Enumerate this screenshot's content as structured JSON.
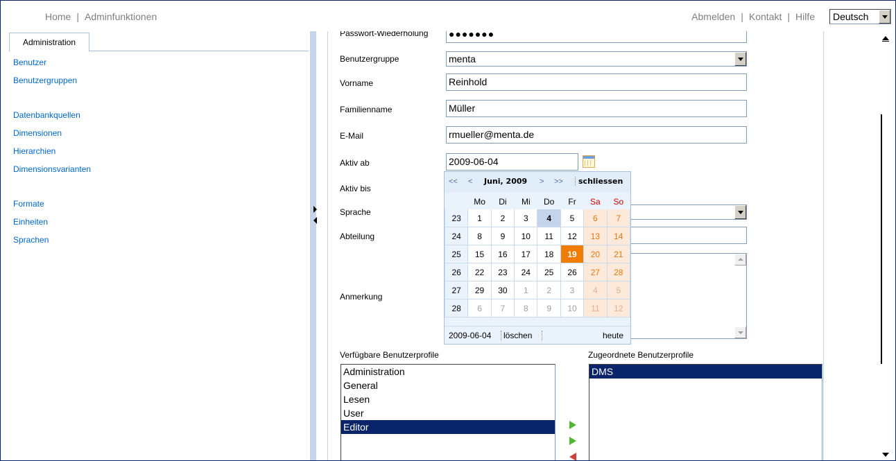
{
  "top_nav": {
    "left": [
      "Home",
      "Adminfunktionen"
    ],
    "right": [
      "Abmelden",
      "Kontakt",
      "Hilfe"
    ],
    "language_selected": "Deutsch"
  },
  "sidebar": {
    "tab": "Administration",
    "groups": [
      [
        "Benutzer",
        "Benutzergruppen"
      ],
      [
        "Datenbankquellen",
        "Dimensionen",
        "Hierarchien",
        "Dimensionsvarianten"
      ],
      [
        "Formate",
        "Einheiten",
        "Sprachen"
      ]
    ]
  },
  "form": {
    "password_repeat_label": "Passwort-Wiederholung",
    "password_repeat_value": "●●●●●●●",
    "group_label": "Benutzergruppe",
    "group_value": "menta",
    "firstname_label": "Vorname",
    "firstname_value": "Reinhold",
    "lastname_label": "Familienname",
    "lastname_value": "Müller",
    "email_label": "E-Mail",
    "email_value": "rmueller@menta.de",
    "active_from_label": "Aktiv ab",
    "active_from_value": "2009-06-04",
    "active_to_label": "Aktiv bis",
    "language_label": "Sprache",
    "department_label": "Abteilung",
    "note_label": "Anmerkung"
  },
  "calendar": {
    "nav": [
      "<<",
      "<",
      ">",
      ">>"
    ],
    "month": "Juni, 2009",
    "close": "schliessen",
    "weekdays": [
      "Mo",
      "Di",
      "Mi",
      "Do",
      "Fr",
      "Sa",
      "So"
    ],
    "weeks": [
      {
        "wk": "23",
        "days": [
          "1",
          "2",
          "3",
          "4",
          "5",
          "6",
          "7"
        ]
      },
      {
        "wk": "24",
        "days": [
          "8",
          "9",
          "10",
          "11",
          "12",
          "13",
          "14"
        ]
      },
      {
        "wk": "25",
        "days": [
          "15",
          "16",
          "17",
          "18",
          "19",
          "20",
          "21"
        ]
      },
      {
        "wk": "26",
        "days": [
          "22",
          "23",
          "24",
          "25",
          "26",
          "27",
          "28"
        ]
      },
      {
        "wk": "27",
        "days": [
          "29",
          "30",
          "1",
          "2",
          "3",
          "4",
          "5"
        ]
      },
      {
        "wk": "28",
        "days": [
          "6",
          "7",
          "8",
          "9",
          "10",
          "11",
          "12"
        ]
      }
    ],
    "selected_day": "4",
    "today": "19",
    "footer_date": "2009-06-04",
    "clear": "löschen",
    "today_label": "heute"
  },
  "profiles": {
    "available_label": "Verfügbare Benutzerprofile",
    "available": [
      "Administration",
      "General",
      "Lesen",
      "User",
      "Editor"
    ],
    "available_selected": "Editor",
    "assigned_label": "Zugeordnete Benutzerprofile",
    "assigned": [
      "DMS"
    ],
    "assigned_selected": "DMS"
  },
  "colors": {
    "link": "#0066cc",
    "today": "#f07c00",
    "weekend_bg": "#fde9d9",
    "selection": "#0a246a"
  }
}
